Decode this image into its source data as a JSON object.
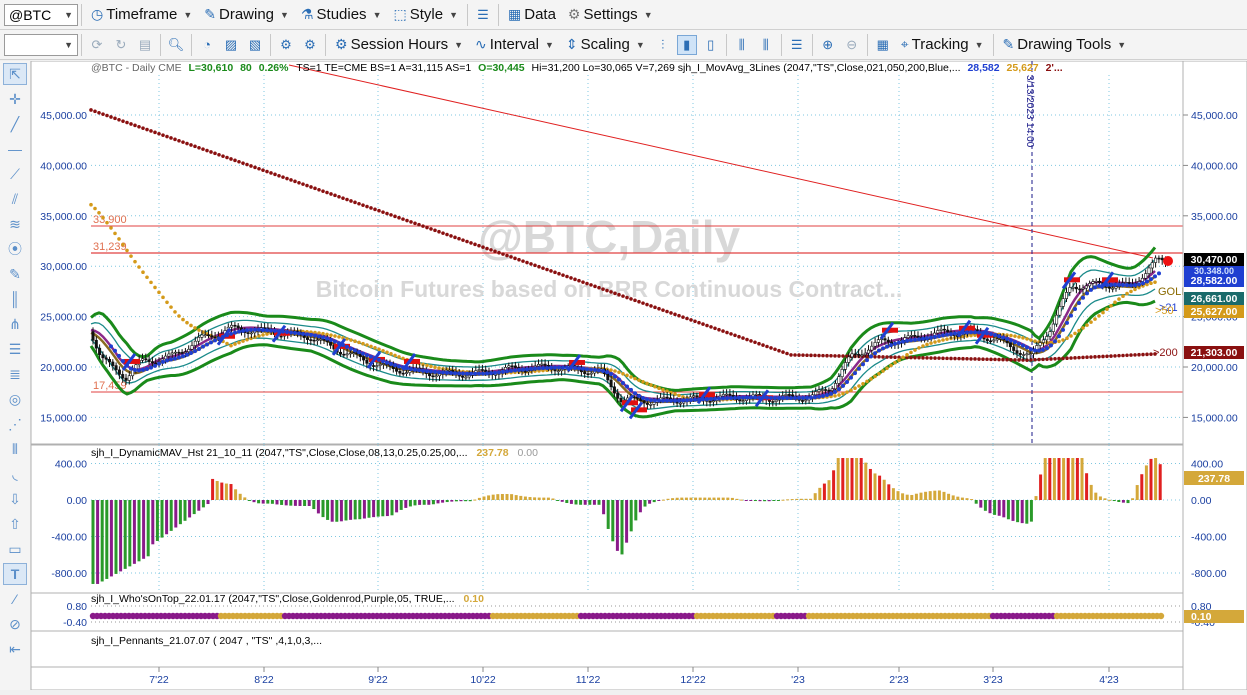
{
  "toolbar1": {
    "symbol": "@BTC",
    "timeframe": "Timeframe",
    "drawing": "Drawing",
    "studies": "Studies",
    "style": "Style",
    "data": "Data",
    "settings": "Settings"
  },
  "toolbar2": {
    "session_hours": "Session Hours",
    "interval": "Interval",
    "scaling": "Scaling",
    "tracking": "Tracking",
    "drawing_tools": "Drawing Tools"
  },
  "chart_header": {
    "symbol_text": "@BTC - Daily  CME",
    "l": "L=30,610",
    "chg": "80",
    "pct": "0.26%",
    "rest": "TS=1  TE=CME  BS=1  A=31,115  AS=1",
    "o": "O=30,445",
    "rest2": "Hi=31,200  Lo=30,065  V=7,269  sjh_I_MovAvg_3Lines (2047,\"TS\",Close,021,050,200,Blue,...",
    "ma1": "28,582",
    "ma2": "25,627",
    "ma3": "2'..."
  },
  "watermark": {
    "title": "@BTC,Daily",
    "subtitle": "Bitcoin Futures based on BRR Continuous Contract..."
  },
  "price_levels": {
    "upper": "33,900",
    "mid": "31,239",
    "lower": "17,459"
  },
  "vline_label": "3/13/2023 14:00",
  "price_axis": [
    "45,000.00",
    "40,000.00",
    "35,000.00",
    "30,000.00",
    "25,000.00",
    "20,000.00",
    "15,000.00"
  ],
  "price_badges": {
    "last": "30,470.00",
    "hidden": "30,348.00",
    "ma21": "28,582.00",
    "band": "26,661.00",
    "ma50": "25,627.00",
    "ma200": "21,303.00"
  },
  "ma_labels": {
    "ma21": ">21",
    "gold": "GOLI",
    "ma50": ">50",
    "ma200": ">200"
  },
  "indicator1": {
    "title": "sjh_I_DynamicMAV_Hst 21_10_11 (2047,\"TS\",Close,Close,08,13,0.25,0.25,00,...",
    "v1": "237.78",
    "v2": "0.00",
    "axis": [
      "400.00",
      "0.00",
      "-400.00",
      "-800.00"
    ],
    "badge": "237.78"
  },
  "indicator2": {
    "title": "sjh_I_Who'sOnTop_22.01.17 (2047,\"TS\",Close,Goldenrod,Purple,05, TRUE,...",
    "v1": "0.10",
    "axis": [
      "0.80",
      "-0.40"
    ],
    "badge": "0.10"
  },
  "indicator3": {
    "title": "sjh_I_Pennants_21.07.07 ( 2047 , \"TS\" ,4,1,0,3,..."
  },
  "time_axis": [
    "7'22",
    "8'22",
    "9'22",
    "10'22",
    "11'22",
    "12'22",
    "'23",
    "2'23",
    "3'23",
    "4'23"
  ],
  "colors": {
    "ma21": "#1f3fd1",
    "ma50": "#d49a1a",
    "ma200": "#8a1010",
    "band": "#1a8a1a",
    "hist_up_gold": "#d4a83a",
    "hist_up_red": "#e02020",
    "hist_dn_green": "#2a9a2a",
    "hist_dn_purple": "#8a1a8a"
  },
  "chart_data": {
    "type": "line",
    "title": "@BTC,Daily",
    "x": [
      "7'22",
      "8'22",
      "9'22",
      "10'22",
      "11'22",
      "12'22",
      "'23",
      "2'23",
      "3'23",
      "4'23"
    ],
    "ylim": [
      13000,
      48500
    ],
    "series": [
      {
        "name": "Close",
        "values": [
          20800,
          22800,
          20000,
          19500,
          16800,
          16700,
          17200,
          23000,
          22800,
          28500
        ]
      },
      {
        "name": ">21",
        "values": [
          20500,
          23000,
          20100,
          19600,
          17500,
          16900,
          19500,
          23500,
          24000,
          28582
        ]
      },
      {
        "name": ">50",
        "values": [
          24000,
          22500,
          21500,
          19800,
          18500,
          17000,
          17800,
          21000,
          22500,
          25627
        ]
      },
      {
        "name": ">200",
        "values": [
          43000,
          38500,
          33000,
          28500,
          25500,
          22500,
          21000,
          20700,
          20500,
          21303
        ]
      }
    ]
  }
}
